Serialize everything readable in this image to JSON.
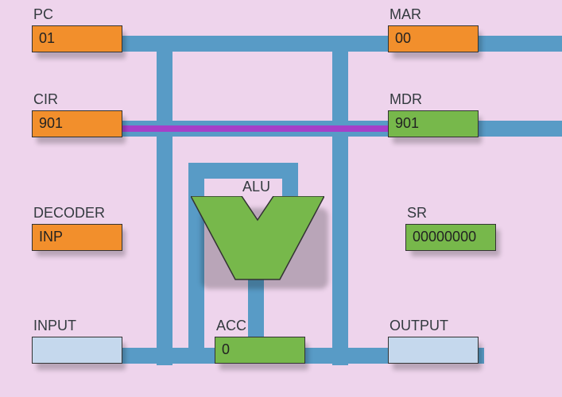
{
  "registers": {
    "pc": {
      "label": "PC",
      "value": "01"
    },
    "mar": {
      "label": "MAR",
      "value": "00"
    },
    "cir": {
      "label": "CIR",
      "value": "901"
    },
    "mdr": {
      "label": "MDR",
      "value": "901"
    },
    "decoder": {
      "label": "DECODER",
      "value": "INP"
    },
    "sr": {
      "label": "SR",
      "value": "00000000"
    },
    "input": {
      "label": "INPUT",
      "value": ""
    },
    "acc": {
      "label": "ACC",
      "value": "0"
    },
    "output": {
      "label": "OUTPUT",
      "value": ""
    },
    "alu": {
      "label": "ALU"
    }
  }
}
